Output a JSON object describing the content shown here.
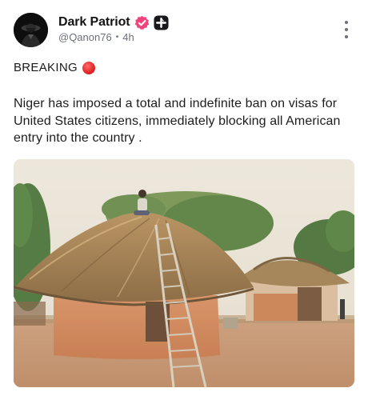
{
  "author": {
    "display_name": "Dark Patriot",
    "handle": "@Qanon76",
    "time": "4h",
    "separator": "•",
    "verified_badge_icon": "verified-badge-icon",
    "plus_badge_icon": "plus-badge-icon"
  },
  "post": {
    "headline": "BREAKING",
    "headline_icon": "red-circle-icon",
    "body": "Niger has imposed a total and indefinite ban on visas for United States citizens, immediately blocking all American entry into the country ."
  },
  "menu": {
    "icon": "more-vertical-icon"
  },
  "colors": {
    "badge_pink": "#f0437b",
    "badge_dark": "#17171c",
    "meta_gray": "#6b6f76",
    "headline_dot": "#e52a2a"
  }
}
